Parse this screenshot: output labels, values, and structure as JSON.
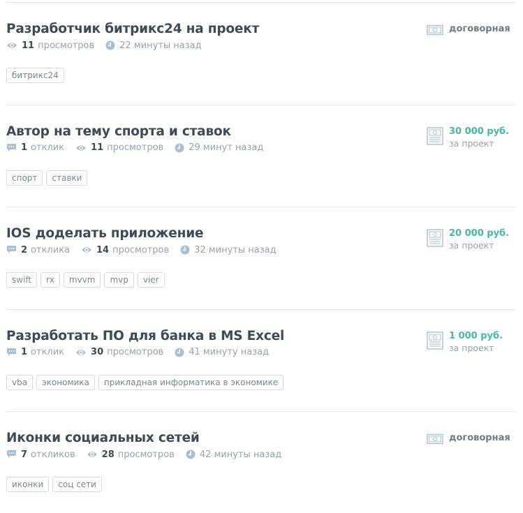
{
  "tasks": [
    {
      "title": "Разработчик битрикс24 на проект",
      "replies": null,
      "views_count": "11",
      "views_label": "просмотров",
      "time": "22 минуты назад",
      "price": "договорная",
      "price_note": "",
      "price_negotiable": true,
      "tags": [
        "битрикс24"
      ]
    },
    {
      "title": "Автор на тему спорта и ставок",
      "replies_count": "1",
      "replies_label": "отклик",
      "views_count": "11",
      "views_label": "просмотров",
      "time": "29 минут назад",
      "price": "30 000 руб.",
      "price_note": "за проект",
      "price_negotiable": false,
      "tags": [
        "спорт",
        "ставки"
      ]
    },
    {
      "title": "IOS доделать приложение",
      "replies_count": "2",
      "replies_label": "отклика",
      "views_count": "14",
      "views_label": "просмотров",
      "time": "32 минуты назад",
      "price": "20 000 руб.",
      "price_note": "за проект",
      "price_negotiable": false,
      "tags": [
        "swift",
        "rx",
        "mvvm",
        "mvp",
        "vier"
      ]
    },
    {
      "title": "Разработать ПО для банка в MS Excel",
      "replies_count": "1",
      "replies_label": "отклик",
      "views_count": "30",
      "views_label": "просмотров",
      "time": "41 минуту назад",
      "price": "1 000 руб.",
      "price_note": "за проект",
      "price_negotiable": false,
      "tags": [
        "vba",
        "экономика",
        "прикладная информатика в экономике"
      ]
    },
    {
      "title": "Иконки социальных сетей",
      "replies_count": "7",
      "replies_label": "откликов",
      "views_count": "28",
      "views_label": "просмотров",
      "time": "42 минуты назад",
      "price": "договорная",
      "price_note": "",
      "price_negotiable": true,
      "tags": [
        "иконки",
        "соц сети"
      ]
    }
  ],
  "colors": {
    "title": "#3d4b57",
    "meta": "#96a2ac",
    "icon": "#a9c0d0",
    "price_accent": "#3fb9a9",
    "tag_border": "#d5dbe0",
    "separator": "#e6e9ec"
  },
  "icons": {
    "replies": "speech-bubble-icon",
    "views": "eye-icon",
    "time": "clock-icon",
    "price_fixed": "price-list-icon",
    "price_negotiable": "banknote-icon"
  }
}
